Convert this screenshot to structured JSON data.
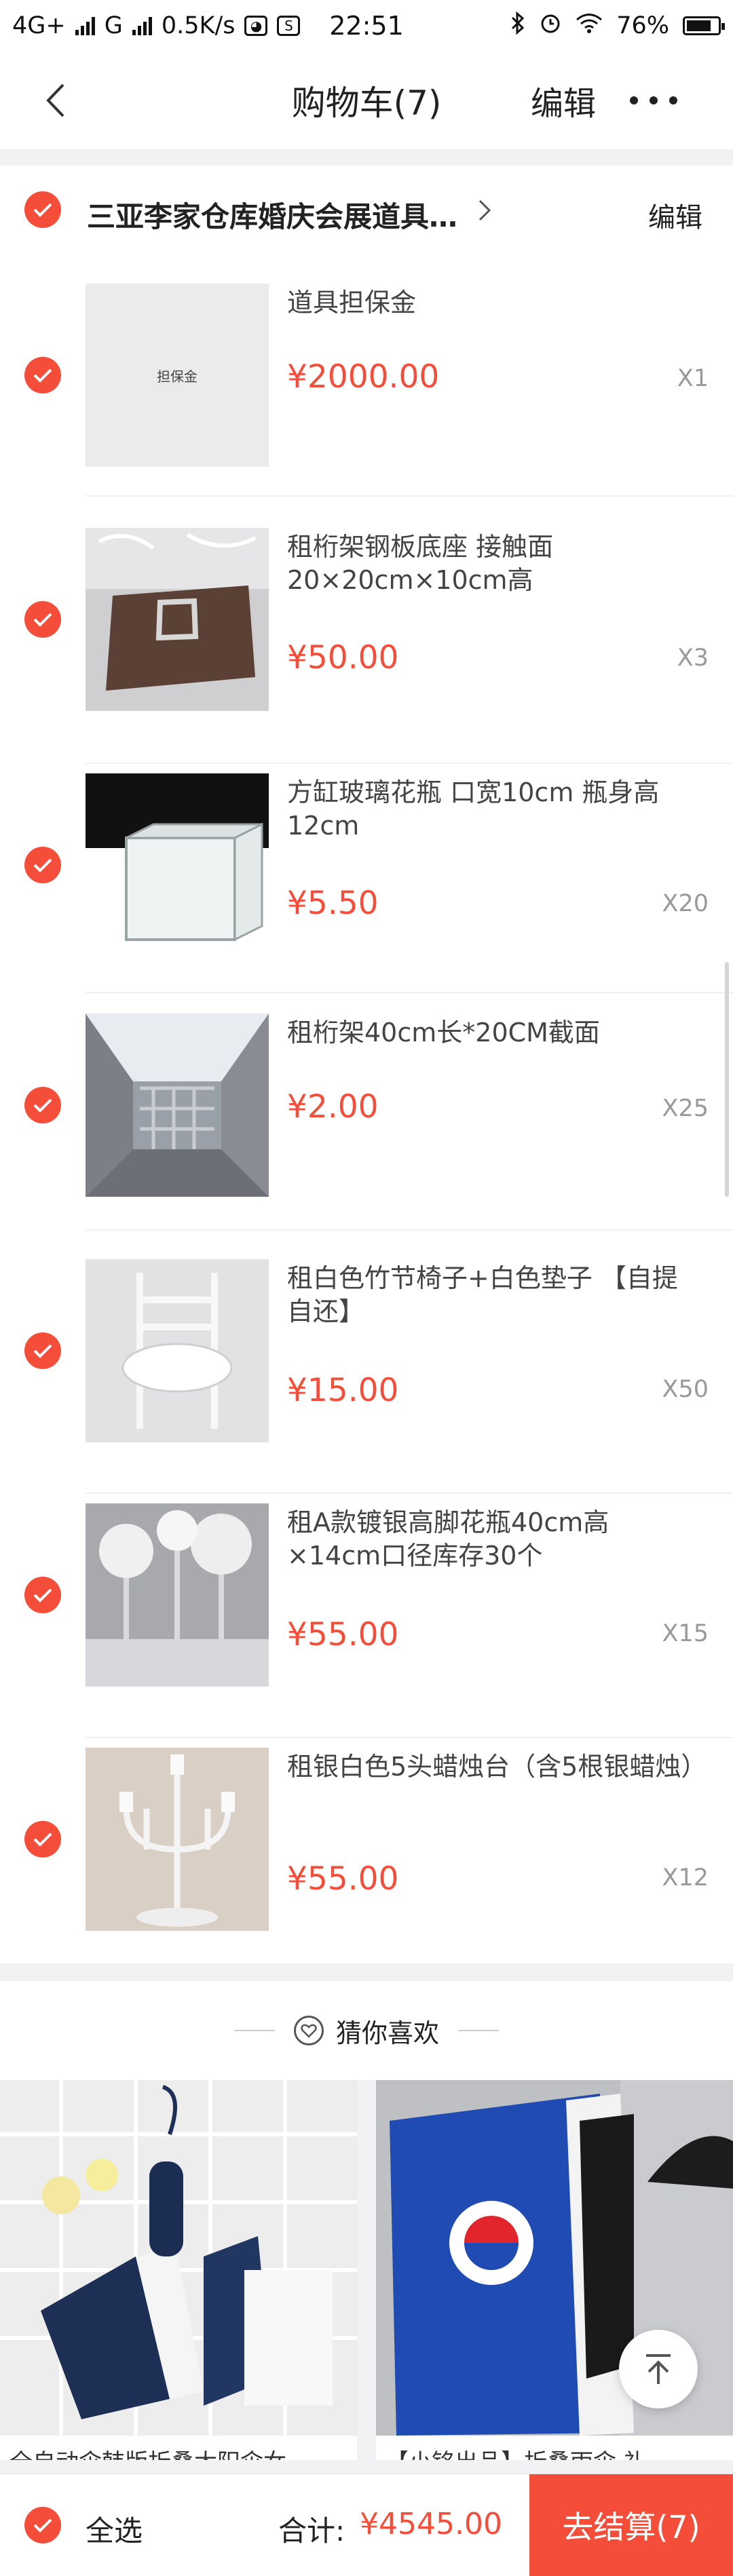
{
  "status_bar": {
    "network": "4G+",
    "network2": "G",
    "speed": "0.5K/s",
    "time": "22:51",
    "battery": "76%"
  },
  "nav": {
    "title": "购物车(7)",
    "edit": "编辑"
  },
  "shop": {
    "name": "三亚李家仓库婚庆会展道具…",
    "edit": "编辑"
  },
  "items": [
    {
      "title": "道具担保金",
      "price": "¥2000.00",
      "qty": "X1",
      "thumb_text": "担保金"
    },
    {
      "title": "租桁架钢板底座 接触面20×20cm×10cm高",
      "price": "¥50.00",
      "qty": "X3"
    },
    {
      "title": "方缸玻璃花瓶 口宽10cm 瓶身高12cm",
      "price": "¥5.50",
      "qty": "X20"
    },
    {
      "title": "租桁架40cm长*20CM截面",
      "price": "¥2.00",
      "qty": "X25"
    },
    {
      "title": "租白色竹节椅子+白色垫子 【自提自还】",
      "price": "¥15.00",
      "qty": "X50"
    },
    {
      "title": "租A款镀银高脚花瓶40cm高×14cm口径库存30个",
      "price": "¥55.00",
      "qty": "X15"
    },
    {
      "title": "租银白色5头蜡烛台（含5根银蜡烛）",
      "price": "¥55.00",
      "qty": "X12"
    }
  ],
  "guess": {
    "label": "猜你喜欢"
  },
  "recommend": [
    {
      "name": "全自动伞韩版折叠太阳伞女…"
    },
    {
      "name": "【小铭出品】折叠雨伞 礼…"
    }
  ],
  "bottom": {
    "select_all": "全选",
    "total_label": "合计:",
    "total_value": "¥4545.00",
    "checkout": "去结算(7)"
  },
  "colors": {
    "accent": "#f44e3b"
  }
}
